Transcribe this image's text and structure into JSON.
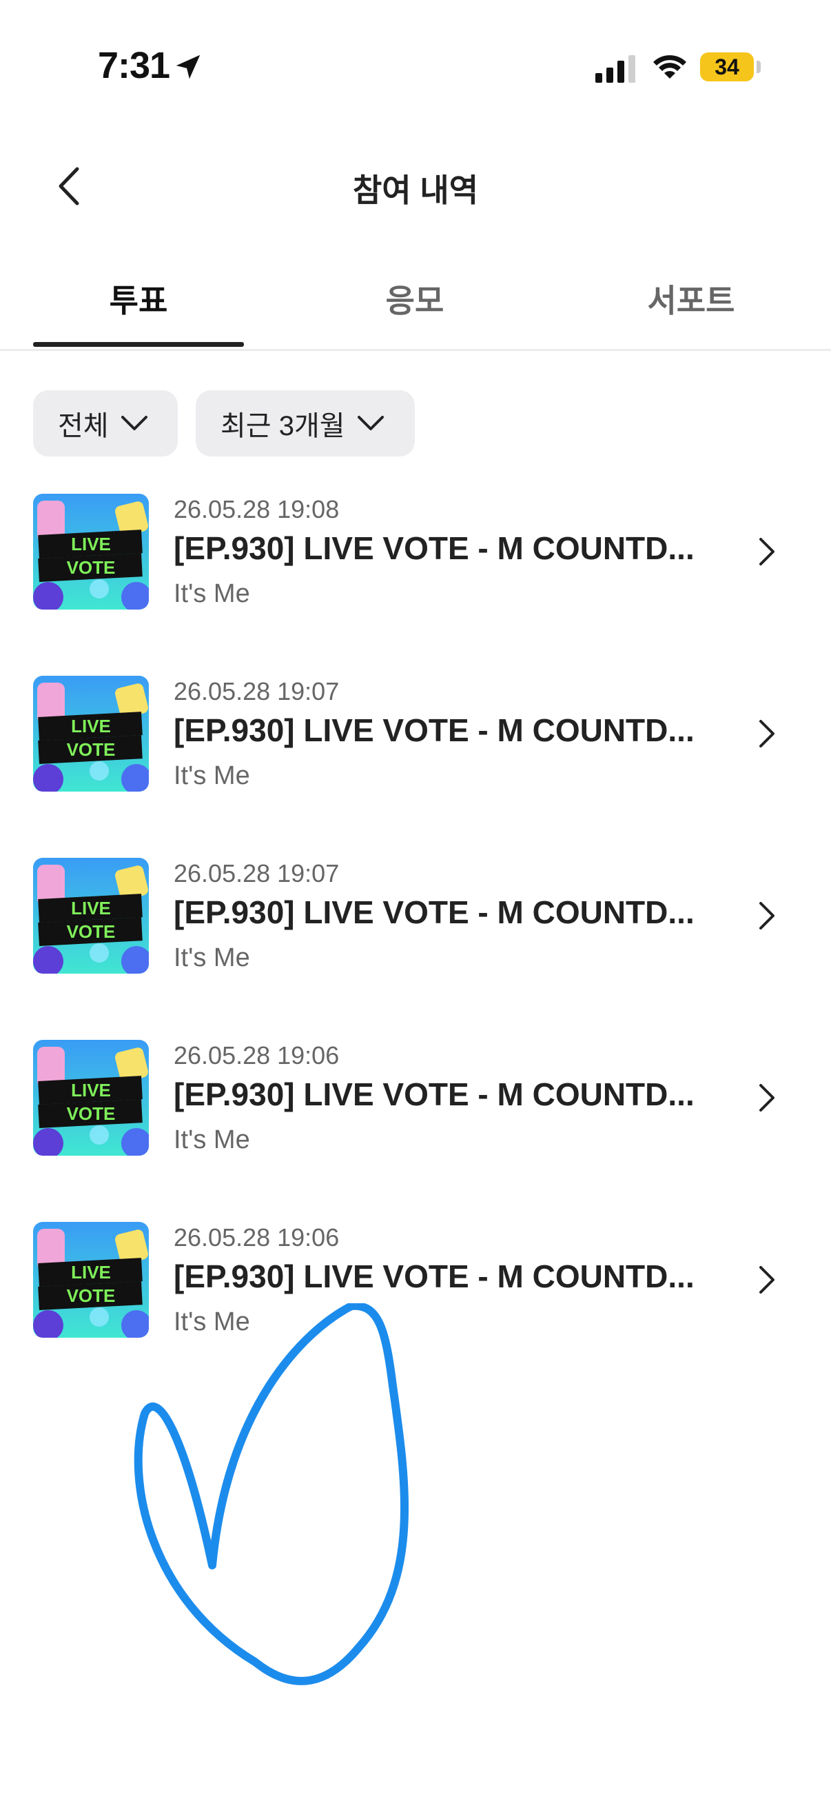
{
  "status_bar": {
    "time": "7:31",
    "battery": "34",
    "icons": [
      "location-arrow-icon",
      "cellular-signal-icon",
      "wifi-icon",
      "battery-icon"
    ],
    "battery_color": "#f6c51b"
  },
  "header": {
    "title": "참여 내역",
    "back_icon": "chevron-left-icon"
  },
  "tabs": [
    {
      "label": "투표",
      "active": true
    },
    {
      "label": "응모",
      "active": false
    },
    {
      "label": "서포트",
      "active": false
    }
  ],
  "filters": [
    {
      "label": "전체",
      "icon": "chevron-down-icon"
    },
    {
      "label": "최근 3개월",
      "icon": "chevron-down-icon"
    }
  ],
  "items": [
    {
      "date": "26.05.28 19:08",
      "title": "[EP.930] LIVE VOTE - M COUNTD...",
      "subtitle": "It's Me",
      "thumb_line1": "LIVE",
      "thumb_line2": "VOTE"
    },
    {
      "date": "26.05.28 19:07",
      "title": "[EP.930] LIVE VOTE - M COUNTD...",
      "subtitle": "It's Me",
      "thumb_line1": "LIVE",
      "thumb_line2": "VOTE"
    },
    {
      "date": "26.05.28 19:07",
      "title": "[EP.930] LIVE VOTE - M COUNTD...",
      "subtitle": "It's Me",
      "thumb_line1": "LIVE",
      "thumb_line2": "VOTE"
    },
    {
      "date": "26.05.28 19:06",
      "title": "[EP.930] LIVE VOTE - M COUNTD...",
      "subtitle": "It's Me",
      "thumb_line1": "LIVE",
      "thumb_line2": "VOTE"
    },
    {
      "date": "26.05.28 19:06",
      "title": "[EP.930] LIVE VOTE - M COUNTD...",
      "subtitle": "It's Me",
      "thumb_line1": "LIVE",
      "thumb_line2": "VOTE"
    }
  ],
  "colors": {
    "heart_stroke": "#1c8cec",
    "thumb_bg_top": "#3a9cf5",
    "thumb_bg_bottom": "#41e6d2",
    "thumb_band": "#111111",
    "thumb_text": "#7ff05a"
  }
}
